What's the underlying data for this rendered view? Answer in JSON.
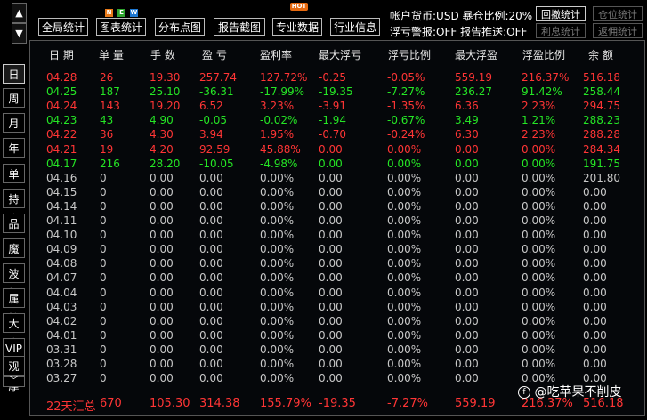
{
  "nav": {
    "up": "▲",
    "down": "▼"
  },
  "toolbar": [
    {
      "label": "全局统计"
    },
    {
      "label": "图表统计"
    },
    {
      "label": "分布点图"
    },
    {
      "label": "报告截图"
    },
    {
      "label": "专业数据"
    },
    {
      "label": "行业信息"
    }
  ],
  "badges": {
    "new_n": "N",
    "new_e": "E",
    "new_w": "W",
    "hot": "HOT"
  },
  "account": {
    "line1": "帐户货币:USD  暴仓比例:20%",
    "line2": "浮亏警报:OFF  报告推送:OFF",
    "btn_undo": "回撤统计",
    "btn_position": "仓位统计",
    "btn_interest": "利息统计",
    "btn_rebate": "返佣统计"
  },
  "sidebar": [
    "日",
    "周",
    "月",
    "年",
    "单币",
    "持仓",
    "品种",
    "魔号",
    "波幅",
    "属性",
    "大字",
    "VIP",
    "观摩",
    "﹀"
  ],
  "columns": [
    "日 期",
    "单 量",
    "手 数",
    "盈 亏",
    "盈利率",
    "最大浮亏",
    "浮亏比例",
    "最大浮盈",
    "浮盈比例",
    "余 额"
  ],
  "rows": [
    {
      "c": "red",
      "v": [
        "04.28",
        "26",
        "19.30",
        "257.74",
        "127.72%",
        "-0.25",
        "-0.05%",
        "559.19",
        "216.37%",
        "516.18"
      ]
    },
    {
      "c": "green",
      "v": [
        "04.25",
        "187",
        "25.10",
        "-36.31",
        "-17.99%",
        "-19.35",
        "-7.27%",
        "236.27",
        "91.42%",
        "258.44"
      ]
    },
    {
      "c": "red",
      "v": [
        "04.24",
        "143",
        "19.20",
        "6.52",
        "3.23%",
        "-3.91",
        "-1.35%",
        "6.36",
        "2.23%",
        "294.75"
      ]
    },
    {
      "c": "green",
      "v": [
        "04.23",
        "43",
        "4.90",
        "-0.05",
        "-0.02%",
        "-1.94",
        "-0.67%",
        "3.49",
        "1.21%",
        "288.23"
      ]
    },
    {
      "c": "red",
      "v": [
        "04.22",
        "36",
        "4.30",
        "3.94",
        "1.95%",
        "-0.70",
        "-0.24%",
        "6.30",
        "2.23%",
        "288.28"
      ]
    },
    {
      "c": "red",
      "v": [
        "04.21",
        "19",
        "4.20",
        "92.59",
        "45.88%",
        "0.00",
        "0.00%",
        "0.00",
        "0.00%",
        "284.34"
      ]
    },
    {
      "c": "green",
      "v": [
        "04.17",
        "216",
        "28.20",
        "-10.05",
        "-4.98%",
        "0.00",
        "0.00%",
        "0.00",
        "0.00%",
        "191.75"
      ]
    },
    {
      "c": "gray",
      "v": [
        "04.16",
        "0",
        "0.00",
        "0.00",
        "0.00%",
        "0.00",
        "0.00%",
        "0.00",
        "0.00%",
        "201.80"
      ]
    },
    {
      "c": "gray",
      "v": [
        "04.15",
        "0",
        "0.00",
        "0.00",
        "0.00%",
        "0.00",
        "0.00%",
        "0.00",
        "0.00%",
        "0.00"
      ]
    },
    {
      "c": "gray",
      "v": [
        "04.14",
        "0",
        "0.00",
        "0.00",
        "0.00%",
        "0.00",
        "0.00%",
        "0.00",
        "0.00%",
        "0.00"
      ]
    },
    {
      "c": "gray",
      "v": [
        "04.11",
        "0",
        "0.00",
        "0.00",
        "0.00%",
        "0.00",
        "0.00%",
        "0.00",
        "0.00%",
        "0.00"
      ]
    },
    {
      "c": "gray",
      "v": [
        "04.10",
        "0",
        "0.00",
        "0.00",
        "0.00%",
        "0.00",
        "0.00%",
        "0.00",
        "0.00%",
        "0.00"
      ]
    },
    {
      "c": "gray",
      "v": [
        "04.09",
        "0",
        "0.00",
        "0.00",
        "0.00%",
        "0.00",
        "0.00%",
        "0.00",
        "0.00%",
        "0.00"
      ]
    },
    {
      "c": "gray",
      "v": [
        "04.08",
        "0",
        "0.00",
        "0.00",
        "0.00%",
        "0.00",
        "0.00%",
        "0.00",
        "0.00%",
        "0.00"
      ]
    },
    {
      "c": "gray",
      "v": [
        "04.07",
        "0",
        "0.00",
        "0.00",
        "0.00%",
        "0.00",
        "0.00%",
        "0.00",
        "0.00%",
        "0.00"
      ]
    },
    {
      "c": "gray",
      "v": [
        "04.04",
        "0",
        "0.00",
        "0.00",
        "0.00%",
        "0.00",
        "0.00%",
        "0.00",
        "0.00%",
        "0.00"
      ]
    },
    {
      "c": "gray",
      "v": [
        "04.03",
        "0",
        "0.00",
        "0.00",
        "0.00%",
        "0.00",
        "0.00%",
        "0.00",
        "0.00%",
        "0.00"
      ]
    },
    {
      "c": "gray",
      "v": [
        "04.02",
        "0",
        "0.00",
        "0.00",
        "0.00%",
        "0.00",
        "0.00%",
        "0.00",
        "0.00%",
        "0.00"
      ]
    },
    {
      "c": "gray",
      "v": [
        "04.01",
        "0",
        "0.00",
        "0.00",
        "0.00%",
        "0.00",
        "0.00%",
        "0.00",
        "0.00%",
        "0.00"
      ]
    },
    {
      "c": "gray",
      "v": [
        "03.31",
        "0",
        "0.00",
        "0.00",
        "0.00%",
        "0.00",
        "0.00%",
        "0.00",
        "0.00%",
        "0.00"
      ]
    },
    {
      "c": "gray",
      "v": [
        "03.28",
        "0",
        "0.00",
        "0.00",
        "0.00%",
        "0.00",
        "0.00%",
        "0.00",
        "0.00%",
        "0.00"
      ]
    },
    {
      "c": "gray",
      "v": [
        "03.27",
        "0",
        "0.00",
        "0.00",
        "0.00%",
        "0.00",
        "0.00%",
        "0.00",
        "0.00%",
        "0.00"
      ]
    }
  ],
  "footer": [
    "22天汇总",
    "670",
    "105.30",
    "314.38",
    "155.79%",
    "-19.35",
    "-7.27%",
    "559.19",
    "216.37%",
    "516.18"
  ],
  "watermark": "@吃苹果不削皮",
  "colors": {
    "up": "#ff3535",
    "down": "#25e525",
    "flat": "#c8c8c8"
  }
}
